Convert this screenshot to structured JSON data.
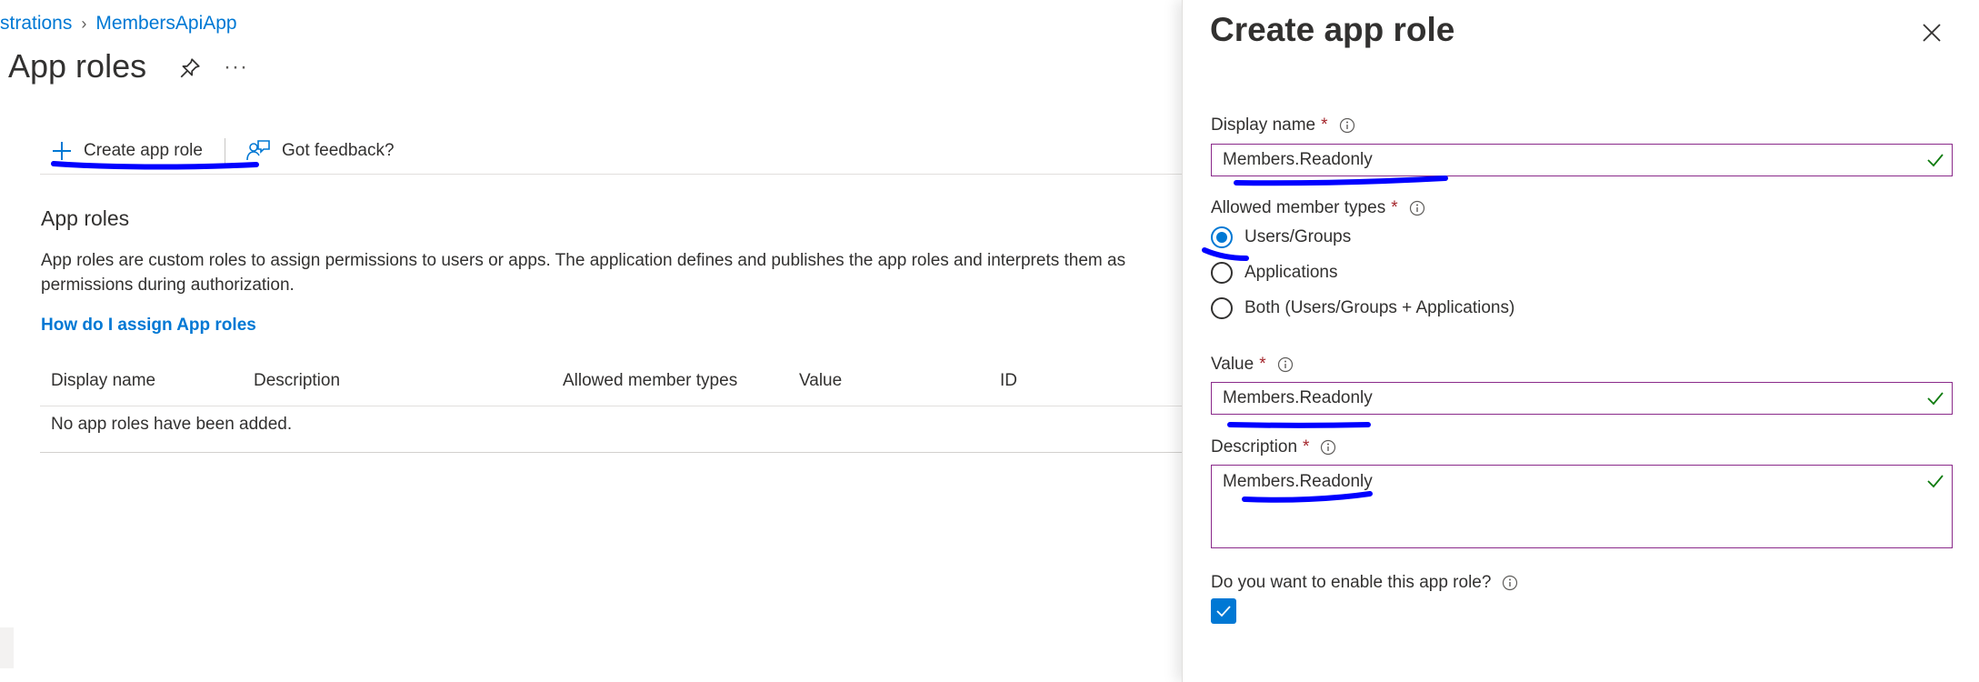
{
  "breadcrumb": {
    "parent": "strations",
    "current": "MembersApiApp"
  },
  "page": {
    "title": "App roles",
    "more_label": "···"
  },
  "commands": {
    "create": "Create app role",
    "feedback": "Got feedback?"
  },
  "section": {
    "title": "App roles",
    "description": "App roles are custom roles to assign permissions to users or apps. The application defines and publishes the app roles and interprets them as permissions during authorization.",
    "help_link": "How do I assign App roles"
  },
  "table": {
    "columns": [
      "Display name",
      "Description",
      "Allowed member types",
      "Value",
      "ID"
    ],
    "empty_text": "No app roles have been added."
  },
  "panel": {
    "title": "Create app role",
    "display_name": {
      "label": "Display name",
      "required": "*",
      "value": "Members.Readonly"
    },
    "member_types": {
      "label": "Allowed member types",
      "required": "*",
      "options": [
        "Users/Groups",
        "Applications",
        "Both (Users/Groups + Applications)"
      ],
      "selected": "Users/Groups"
    },
    "value": {
      "label": "Value",
      "required": "*",
      "value": "Members.Readonly"
    },
    "description": {
      "label": "Description",
      "required": "*",
      "value": "Members.Readonly"
    },
    "enable": {
      "label": "Do you want to enable this app role?",
      "checked": true
    }
  },
  "colors": {
    "accent": "#0078d4",
    "field_border": "#8a2a8a",
    "valid_check": "#107c10",
    "required": "#a4262c",
    "annotation_marker": "#0000ff"
  },
  "icons": {
    "breadcrumb_separator": "chevron-right-icon",
    "pin": "pin-icon",
    "create": "plus-icon",
    "feedback": "feedback-icon",
    "close": "close-icon",
    "info": "info-icon",
    "valid": "checkmark-icon"
  }
}
